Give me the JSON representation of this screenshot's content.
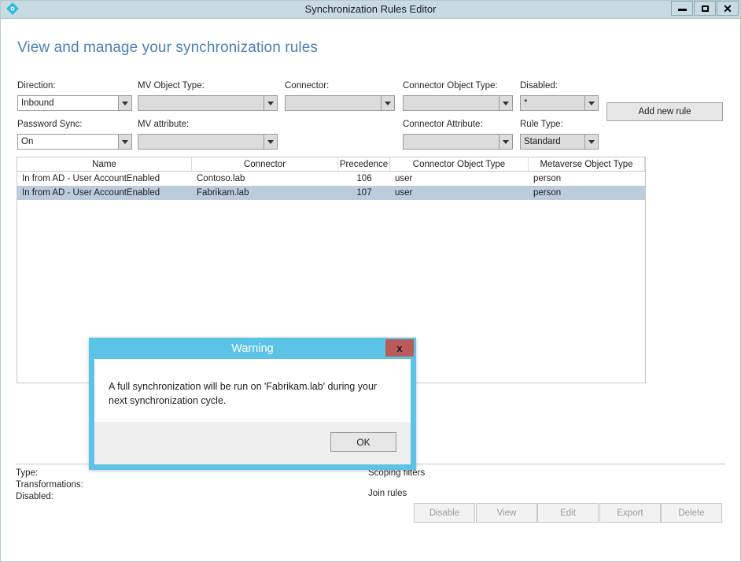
{
  "window": {
    "title": "Synchronization Rules Editor",
    "icon": "sync-diamond-icon",
    "controls": {
      "minimize": "minimize-icon",
      "maximize": "maximize-icon",
      "close": "close-icon"
    }
  },
  "page": {
    "heading": "View and manage your synchronization rules"
  },
  "filters": {
    "fields": [
      {
        "label": "Direction:",
        "value": "Inbound",
        "enabled": true,
        "name": "direction"
      },
      {
        "label": "MV Object Type:",
        "value": "",
        "enabled": false,
        "name": "mv-object-type"
      },
      {
        "label": "Connector:",
        "value": "",
        "enabled": false,
        "name": "connector"
      },
      {
        "label": "Connector Object Type:",
        "value": "",
        "enabled": false,
        "name": "connector-object-type"
      },
      {
        "label": "Disabled:",
        "value": "*",
        "enabled": false,
        "name": "disabled"
      },
      {
        "label": "Password Sync:",
        "value": "On",
        "enabled": true,
        "name": "password-sync"
      },
      {
        "label": "MV attribute:",
        "value": "",
        "enabled": false,
        "name": "mv-attribute"
      },
      {
        "label": "Connector Attribute:",
        "value": "",
        "enabled": false,
        "name": "connector-attribute"
      },
      {
        "label": "Rule Type:",
        "value": "Standard",
        "enabled": false,
        "name": "rule-type"
      }
    ],
    "add_new_rule_label": "Add new rule"
  },
  "grid": {
    "columns": [
      "Name",
      "Connector",
      "Precedence",
      "Connector Object Type",
      "Metaverse Object Type"
    ],
    "rows": [
      {
        "name": "In from AD - User AccountEnabled",
        "connector": "Contoso.lab",
        "precedence": "106",
        "connector_object_type": "user",
        "metaverse_object_type": "person",
        "selected": false
      },
      {
        "name": "In from AD - User AccountEnabled",
        "connector": "Fabrikam.lab",
        "precedence": "107",
        "connector_object_type": "user",
        "metaverse_object_type": "person",
        "selected": true
      }
    ]
  },
  "details": {
    "left": [
      "Type:",
      "Transformations:",
      "Disabled:"
    ],
    "right": [
      "Scoping filters",
      "Join rules"
    ]
  },
  "actions": [
    {
      "label": "Disable",
      "name": "disable-button",
      "enabled": false
    },
    {
      "label": "View",
      "name": "view-button",
      "enabled": false
    },
    {
      "label": "Edit",
      "name": "edit-button",
      "enabled": false
    },
    {
      "label": "Export",
      "name": "export-button",
      "enabled": false
    },
    {
      "label": "Delete",
      "name": "delete-button",
      "enabled": false
    }
  ],
  "dialog": {
    "title": "Warning",
    "close_label": "x",
    "message": "A full synchronization will be run on 'Fabrikam.lab' during your next synchronization cycle.",
    "ok_label": "OK"
  },
  "colors": {
    "titlebar": "#c7dbe1",
    "heading": "#4d7eb5",
    "dialog_header": "#5bc3e6",
    "dialog_close": "#bb5a5a",
    "row_selected": "#bcccdc",
    "icon_cyan": "#2ec3e8"
  }
}
